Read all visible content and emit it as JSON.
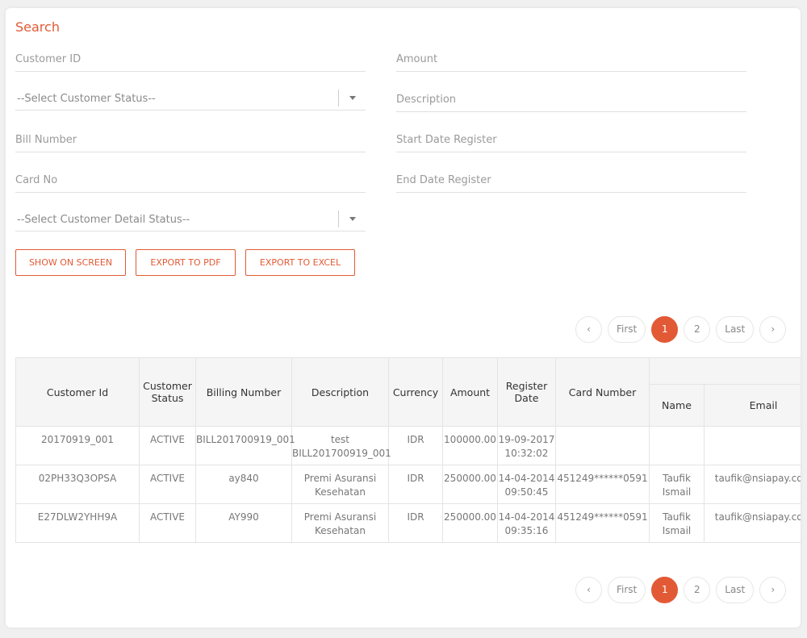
{
  "search": {
    "title": "Search",
    "fields": {
      "customer_id": "Customer ID",
      "amount": "Amount",
      "customer_status": "--Select Customer Status--",
      "description": "Description",
      "bill_number": "Bill Number",
      "start_date": "Start Date Register",
      "card_no": "Card No",
      "end_date": "End Date Register",
      "customer_detail_status": "--Select Customer Detail Status--"
    },
    "buttons": {
      "show": "SHOW ON SCREEN",
      "pdf": "EXPORT TO PDF",
      "excel": "EXPORT TO EXCEL"
    }
  },
  "pagination": {
    "prev": "‹",
    "first": "First",
    "page1": "1",
    "page2": "2",
    "last": "Last",
    "next": "›",
    "active_page": 1
  },
  "table": {
    "headers": {
      "customer_id": "Customer Id",
      "customer_status": "Customer Status",
      "billing_number": "Billing Number",
      "description": "Description",
      "currency": "Currency",
      "amount": "Amount",
      "register_date": "Register Date",
      "card_number": "Card Number",
      "name": "Name",
      "email": "Email"
    },
    "rows": [
      {
        "customer_id": "20170919_001",
        "status": "ACTIVE",
        "billing": "BILL201700919_001",
        "description": "test BILL201700919_001",
        "currency": "IDR",
        "amount": "100000.00",
        "register_date": "19-09-2017 10:32:02",
        "card_number": "",
        "name": "",
        "email": ""
      },
      {
        "customer_id": "02PH33Q3OPSA",
        "status": "ACTIVE",
        "billing": "ay840",
        "description": "Premi Asuransi Kesehatan",
        "currency": "IDR",
        "amount": "250000.00",
        "register_date": "14-04-2014 09:50:45",
        "card_number": "451249******0591",
        "name": "Taufik Ismail",
        "email": "taufik@nsiapay.com"
      },
      {
        "customer_id": "E27DLW2YHH9A",
        "status": "ACTIVE",
        "billing": "AY990",
        "description": "Premi Asuransi Kesehatan",
        "currency": "IDR",
        "amount": "250000.00",
        "register_date": "14-04-2014 09:35:16",
        "card_number": "451249******0591",
        "name": "Taufik Ismail",
        "email": "taufik@nsiapay.com"
      }
    ]
  },
  "colors": {
    "accent": "#e25a35"
  }
}
